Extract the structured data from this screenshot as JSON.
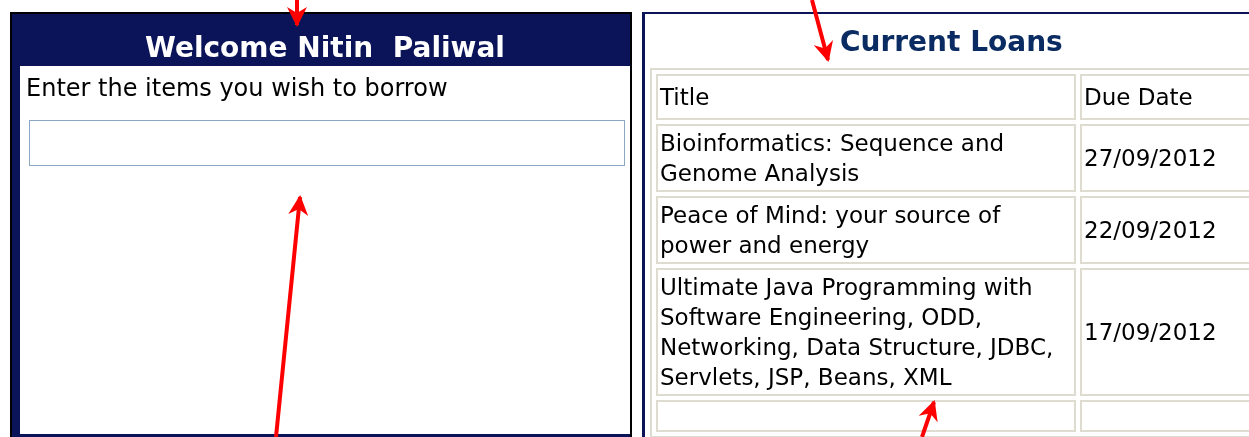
{
  "borrow_panel": {
    "heading": "Welcome Nitin  Paliwal",
    "prompt": "Enter the items you wish to borrow"
  },
  "loans_panel": {
    "heading": "Current Loans",
    "columns": [
      "Title",
      "Due Date"
    ],
    "rows": [
      {
        "title": "Bioinformatics: Sequence and Genome Analysis",
        "due_date": "27/09/2012"
      },
      {
        "title": "Peace of Mind: your source of power and energy",
        "due_date": "22/09/2012"
      },
      {
        "title": "Ultimate Java Programming with Software Engineering, ODD, Networking, Data Structure, JDBC, Servlets, JSP, Beans, XML",
        "due_date": "17/09/2012"
      }
    ]
  }
}
